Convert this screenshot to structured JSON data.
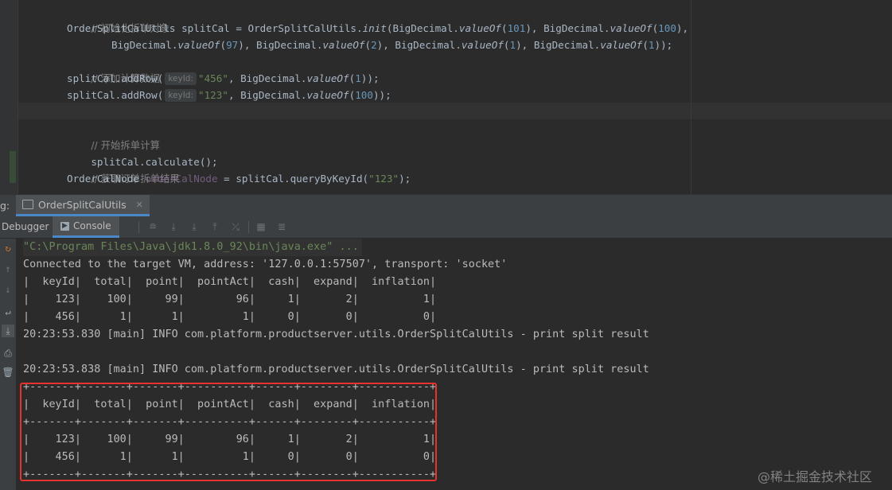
{
  "editor": {
    "line1_comment": "// 初始化拆单对象",
    "line2": {
      "type": "OrderSplitCalUtils",
      "var": "splitCal",
      "eq": " = ",
      "cls": "OrderSplitCalUtils.",
      "method": "init",
      "open": "(BigDecimal.",
      "valueOf": "valueOf",
      "n1": "101",
      "sep1": "), BigDecimal.",
      "n2": "100",
      "tail": "),"
    },
    "line3": {
      "lead": "BigDecimal.",
      "valueOf": "valueOf",
      "n1": "97",
      "sep": "), BigDecimal.",
      "n2": "2",
      "n3": "1",
      "n4": "1",
      "end": "));"
    },
    "line4_comment": "// 添加计算数据",
    "line5": {
      "call": "splitCal.addRow(",
      "hint": "keyId:",
      "str": "\"456\"",
      "mid": ", BigDecimal.",
      "valueOf": "valueOf",
      "num": "1",
      "end": "));"
    },
    "line6": {
      "call": "splitCal.addRow(",
      "hint": "keyId:",
      "str": "\"123\"",
      "mid": ", BigDecimal.",
      "valueOf": "valueOf",
      "num": "100",
      "end": "));"
    },
    "line8_comment": "// 开始拆单计算",
    "line9": "splitCal.calculate();",
    "line10_comment": "// 获取订单拆单结果",
    "line11": {
      "type": "OrderCalNode ",
      "var": "orderCalNode",
      "mid": " = splitCal.queryByKeyId(",
      "str": "\"123\"",
      "end": ");"
    }
  },
  "debug": {
    "label": "g:",
    "session_tab": "OrderSplitCalUtils",
    "tab_debugger": "Debugger",
    "tab_console": "Console"
  },
  "console": {
    "lines": [
      "\"C:\\Program Files\\Java\\jdk1.8.0_92\\bin\\java.exe\" ...",
      "Connected to the target VM, address: '127.0.0.1:57507', transport: 'socket'",
      "|  keyId|  total|  point|  pointAct|  cash|  expand|  inflation|",
      "|    123|    100|     99|        96|     1|       2|          1|",
      "|    456|      1|      1|         1|     0|       0|          0|",
      "20:23:53.830 [main] INFO com.platform.productserver.utils.OrderSplitCalUtils - print split result",
      "",
      "20:23:53.838 [main] INFO com.platform.productserver.utils.OrderSplitCalUtils - print split result",
      "+-------+-------+-------+----------+------+--------+-----------+",
      "|  keyId|  total|  point|  pointAct|  cash|  expand|  inflation|",
      "+-------+-------+-------+----------+------+--------+-----------+",
      "|    123|    100|     99|        96|     1|       2|          1|",
      "|    456|      1|      1|         1|     0|       0|          0|",
      "+-------+-------+-------+----------+------+--------+-----------+"
    ]
  },
  "watermark": "@稀土掘金技术社区"
}
